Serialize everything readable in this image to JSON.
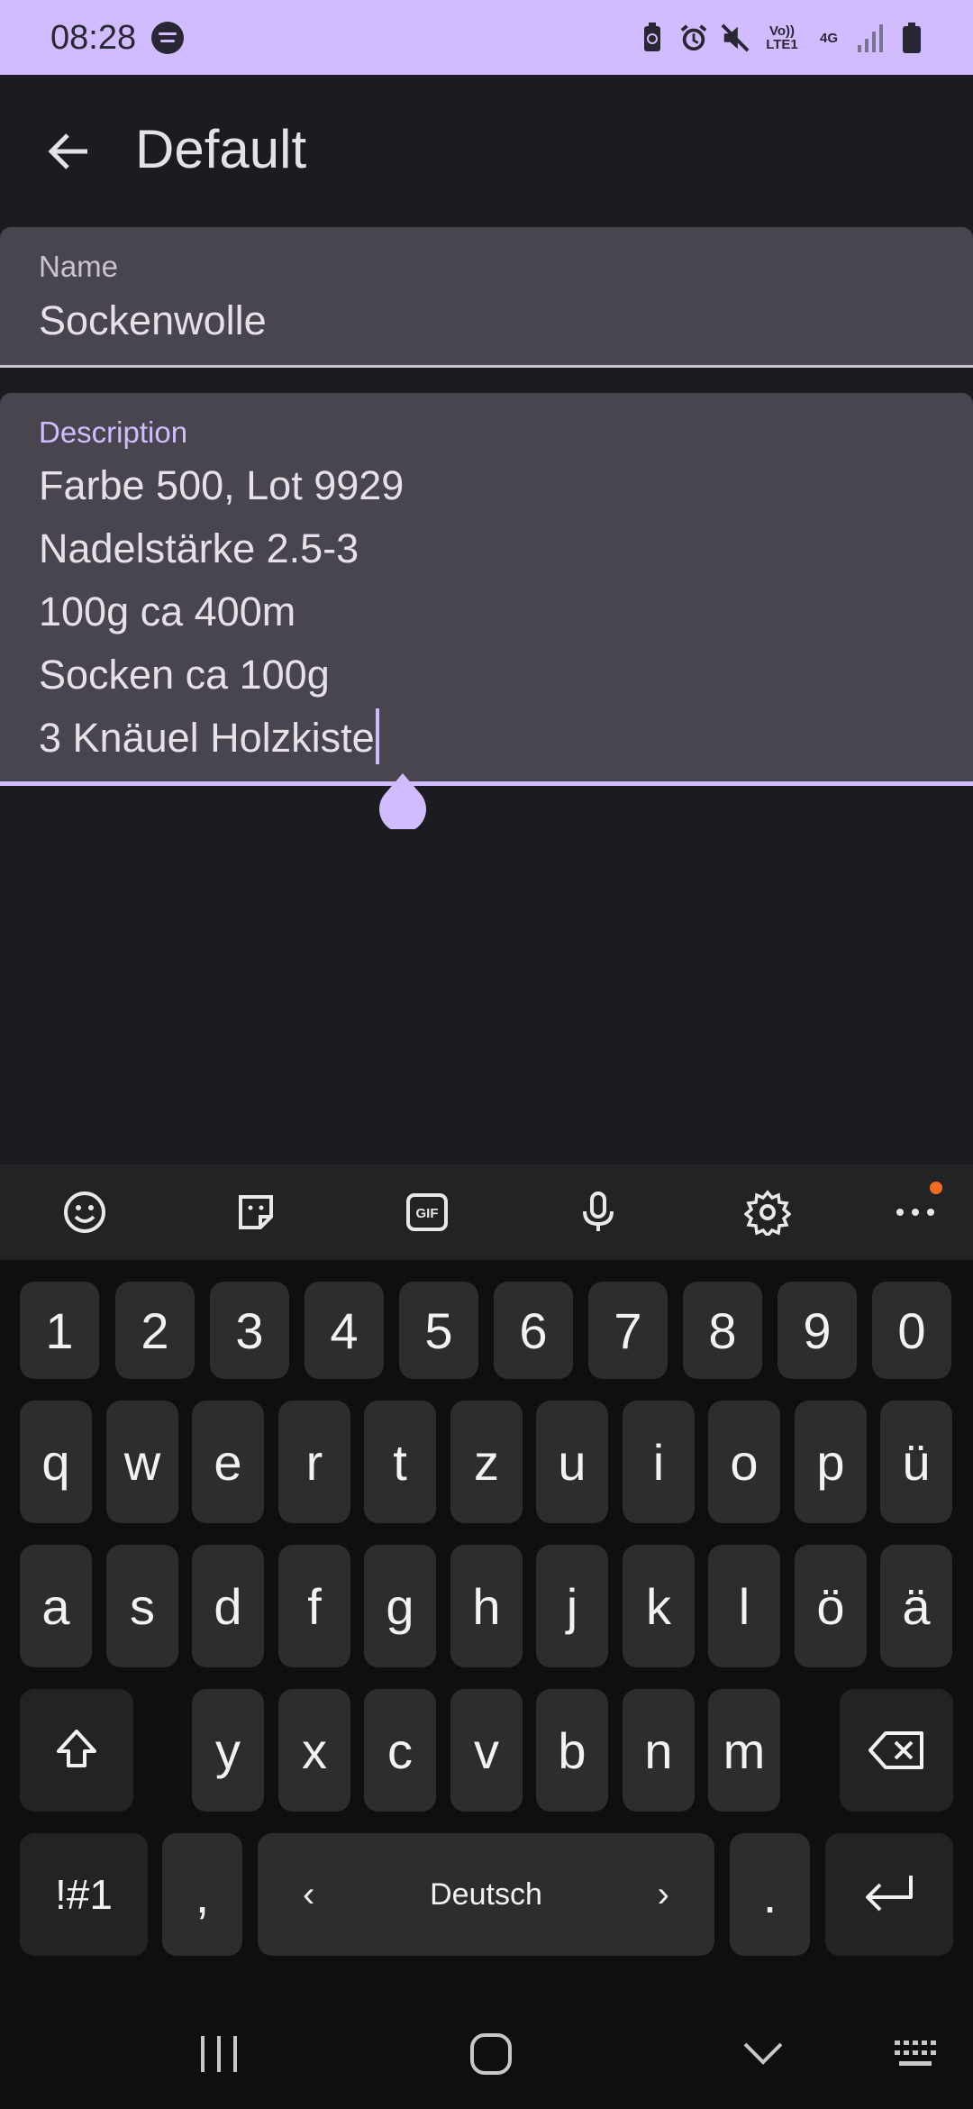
{
  "status_bar": {
    "time": "08:28",
    "network_label": "Vo)) LTE1",
    "network_type": "4G",
    "icons": [
      "spotify-icon",
      "battery-saver-icon",
      "alarm-icon",
      "mute-icon",
      "volte-icon",
      "4g-icon",
      "signal-icon",
      "battery-icon"
    ]
  },
  "app_bar": {
    "title": "Default",
    "back_icon": "arrow-back-icon"
  },
  "form": {
    "name": {
      "label": "Name",
      "value": "Sockenwolle"
    },
    "description": {
      "label": "Description",
      "lines": [
        "Farbe 500, Lot 9929",
        "Nadelstärke 2.5-3",
        "100g ca 400m",
        "Socken ca 100g",
        "3 Knäuel Holzkiste"
      ]
    }
  },
  "keyboard": {
    "toolbar": [
      "emoji-icon",
      "sticker-icon",
      "gif-icon",
      "mic-icon",
      "settings-icon",
      "more-icon"
    ],
    "gif_label": "GIF",
    "number_row": [
      "1",
      "2",
      "3",
      "4",
      "5",
      "6",
      "7",
      "8",
      "9",
      "0"
    ],
    "row_q": [
      "q",
      "w",
      "e",
      "r",
      "t",
      "z",
      "u",
      "i",
      "o",
      "p",
      "ü"
    ],
    "row_a": [
      "a",
      "s",
      "d",
      "f",
      "g",
      "h",
      "j",
      "k",
      "l",
      "ö",
      "ä"
    ],
    "row_y": [
      "y",
      "x",
      "c",
      "v",
      "b",
      "n",
      "m"
    ],
    "symbols_label": "!#1",
    "comma_label": ",",
    "space_label": "Deutsch",
    "space_left": "‹",
    "space_right": "›",
    "period_label": "."
  },
  "colors": {
    "accent": "#d0bcff",
    "background": "#1c1b21",
    "field_bg": "#48454f",
    "key_bg": "#2d2d30",
    "notification_dot": "#f26c22"
  },
  "nav_bar": [
    "recents-icon",
    "home-icon",
    "back-down-icon",
    "keyboard-switch-icon"
  ]
}
